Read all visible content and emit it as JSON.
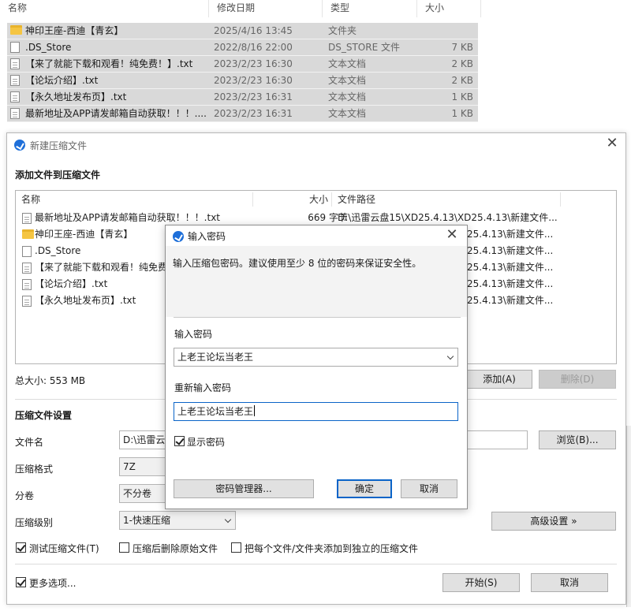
{
  "explorer": {
    "columns": [
      "名称",
      "修改日期",
      "类型",
      "大小"
    ],
    "rows": [
      {
        "name": "神印王座-西迪【青玄】",
        "date": "2025/4/16 13:45",
        "type": "文件夹",
        "size": "",
        "kind": "folder"
      },
      {
        "name": ".DS_Store",
        "date": "2022/8/16 22:00",
        "type": "DS_STORE 文件",
        "size": "7 KB",
        "kind": "blank"
      },
      {
        "name": "【来了就能下载和观看！纯免费！】.txt",
        "date": "2023/2/23 16:30",
        "type": "文本文档",
        "size": "2 KB",
        "kind": "text"
      },
      {
        "name": "【论坛介绍】.txt",
        "date": "2023/2/23 16:30",
        "type": "文本文档",
        "size": "2 KB",
        "kind": "text"
      },
      {
        "name": "【永久地址发布页】.txt",
        "date": "2023/2/23 16:31",
        "type": "文本文档",
        "size": "1 KB",
        "kind": "text"
      },
      {
        "name": "最新地址及APP请发邮箱自动获取！！！....",
        "date": "2023/2/23 16:31",
        "type": "文本文档",
        "size": "1 KB",
        "kind": "text"
      }
    ]
  },
  "archive_window": {
    "title": "新建压缩文件",
    "add_section_title": "添加文件到压缩文件",
    "list_columns": {
      "name": "名称",
      "size": "大小",
      "path": "文件路径"
    },
    "files": [
      {
        "name": "最新地址及APP请发邮箱自动获取！！！.txt",
        "size": "669 字节",
        "path": "D:\\迅雷云盘15\\XD25.4.13\\XD25.4.13\\新建文件...",
        "kind": "text"
      },
      {
        "name": "神印王座-西迪【青玄】",
        "size": "",
        "path": "25.4.13\\新建文件...",
        "kind": "folder"
      },
      {
        "name": ".DS_Store",
        "size": "",
        "path": "25.4.13\\新建文件...",
        "kind": "blank"
      },
      {
        "name": "【来了就能下载和观看！纯免费",
        "size": "",
        "path": "25.4.13\\新建文件...",
        "kind": "text"
      },
      {
        "name": "【论坛介绍】.txt",
        "size": "",
        "path": "25.4.13\\新建文件...",
        "kind": "text"
      },
      {
        "name": "【永久地址发布页】.txt",
        "size": "",
        "path": "25.4.13\\新建文件...",
        "kind": "text"
      }
    ],
    "total_size": "总大小: 553 MB",
    "add_button": "添加(A)",
    "delete_button": "删除(D)",
    "settings_title": "压缩文件设置",
    "filename_label": "文件名",
    "filename_value": "D:\\迅雷云",
    "browse_button": "浏览(B)...",
    "format_label": "压缩格式",
    "format_value": "7Z",
    "split_label": "分卷",
    "split_value": "不分卷",
    "level_label": "压缩级别",
    "level_value": "1-快速压缩",
    "advanced_button": "高级设置 »",
    "test_checkbox": "测试压缩文件(T)",
    "delete_source_checkbox": "压缩后删除原始文件",
    "separate_checkbox": "把每个文件/文件夹添加到独立的压缩文件",
    "more_options_checkbox": "更多选项...",
    "start_button": "开始(S)",
    "cancel_button": "取消"
  },
  "password_dialog": {
    "title": "输入密码",
    "hint": "输入压缩包密码。建议使用至少 8 位的密码来保证安全性。",
    "password_label": "输入密码",
    "password_value": "上老王论坛当老王",
    "reenter_label": "重新输入密码",
    "reenter_value": "上老王论坛当老王",
    "show_password": "显示密码",
    "manager_button": "密码管理器...",
    "ok_button": "确定",
    "cancel_button": "取消"
  },
  "colors": {
    "accent": "#0a64c8",
    "selection": "#d9d9d9",
    "folder": "#f5c542",
    "logo": "#1e6fd9"
  }
}
